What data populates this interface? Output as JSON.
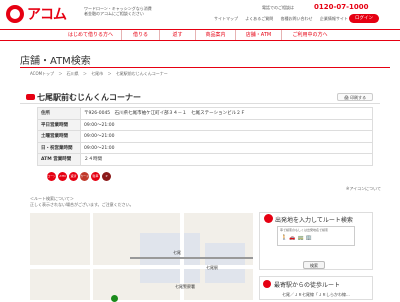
{
  "header": {
    "logo_text": "アコム",
    "tagline": "ワードローン・キャッシングなら消費者金融のアコムにご相談ください",
    "phone_label": "電話でのご相談は",
    "phone_number": "0120-07-1000",
    "util_links": [
      "サイトマップ",
      "よくあるご質問",
      "各種お問い合わせ",
      "企業情報サイト"
    ],
    "login_label": "ログイン"
  },
  "nav": {
    "items": [
      "はじめて借りる方へ",
      "借りる",
      "返す",
      "商品案内",
      "店舗・ATM",
      "ご利用中の方へ"
    ]
  },
  "page": {
    "title": "店舗・ATM検索",
    "breadcrumb": [
      "ACOMトップ",
      "＞",
      "石川県",
      "＞",
      "七尾市",
      "＞",
      "七尾駅前むじんくんコーナー"
    ]
  },
  "store": {
    "name": "七尾駅前むじんくんコーナー",
    "print_label": "印刷する",
    "rows": [
      {
        "label": "住所",
        "value": "〒926-0045　石川県七尾市袖ケ江町イ部３４－１　七尾ステーションビル２Ｆ"
      },
      {
        "label": "平日営業時間",
        "value": "09:00～21:00"
      },
      {
        "label": "土曜営業時間",
        "value": "09:00～21:00"
      },
      {
        "label": "日・祝営業時間",
        "value": "09:00～21:00"
      },
      {
        "label": "ATM 営業時間",
        "value": "２４時間"
      }
    ],
    "service_icons": [
      "ローン",
      "ATM",
      "返済",
      "カード",
      "駐車",
      "P"
    ],
    "icon_note": "※アイコンについて"
  },
  "route_note": {
    "line1": "＜ルート検索について＞",
    "line2": "正しく表示されない場合がございます。ご注意ください。"
  },
  "map": {
    "station_label": "七尾",
    "building_label": "七尾駅",
    "town_label": "七尾警察署"
  },
  "route_search": {
    "title": "出発地を入力してルート検索",
    "input_label": "車で検索のもしくは出発地名で検索",
    "input_icons": "🚶🚗🚃🏢",
    "button_label": "検索"
  },
  "nearby": {
    "title": "最寄駅からの徒歩ルート",
    "text": "七尾／ＪＲ七尾線「ＪＲしらかわ線..."
  },
  "colors": {
    "accent": "#e60012"
  }
}
